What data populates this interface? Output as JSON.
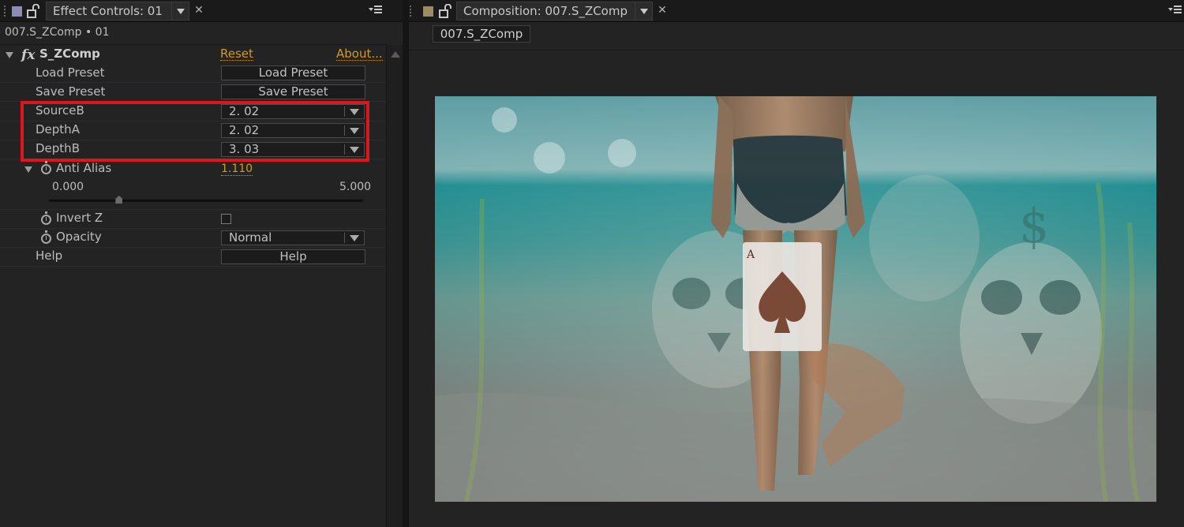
{
  "effect_controls": {
    "tab_title": "Effect Controls: 01",
    "layer_path": "007.S_ZComp • 01",
    "effect": {
      "name": "S_ZComp",
      "reset_label": "Reset",
      "about_label": "About..."
    },
    "properties": {
      "load_preset": {
        "label": "Load Preset",
        "button": "Load Preset"
      },
      "save_preset": {
        "label": "Save Preset",
        "button": "Save Preset"
      },
      "source_b": {
        "label": "SourceB",
        "value": "2. 02"
      },
      "depth_a": {
        "label": "DepthA",
        "value": "2. 02"
      },
      "depth_b": {
        "label": "DepthB",
        "value": "3. 03"
      },
      "anti_alias": {
        "label": "Anti Alias",
        "value": "1.110",
        "min": "0.000",
        "max": "5.000"
      },
      "invert_z": {
        "label": "Invert Z"
      },
      "opacity": {
        "label": "Opacity",
        "value": "Normal"
      },
      "help": {
        "label": "Help",
        "button": "Help"
      }
    }
  },
  "composition": {
    "tab_title": "Composition: 007.S_ZComp",
    "subtab": "007.S_ZComp",
    "card": {
      "rank": "A"
    }
  },
  "colors": {
    "accent_link": "#d39a22",
    "highlight_box": "#e0141b",
    "effect_controls_swatch": "#8c8cb8",
    "composition_swatch": "#9a8a66"
  }
}
